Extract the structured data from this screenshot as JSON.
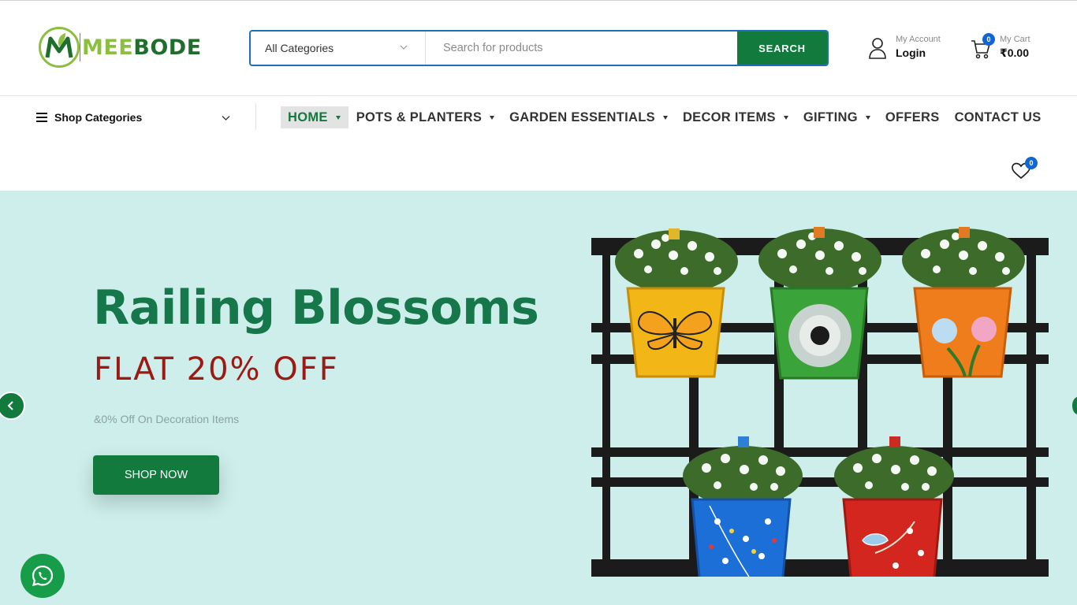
{
  "header": {
    "logo_text": "MEEBODE",
    "search": {
      "category_label": "All Categories",
      "placeholder": "Search for products",
      "button_label": "SEARCH"
    },
    "account": {
      "small_label": "My Account",
      "big_label": "Login"
    },
    "cart": {
      "small_label": "My Cart",
      "amount": "₹0.00",
      "count": "0"
    }
  },
  "nav": {
    "shop_categories_label": "Shop Categories",
    "items": [
      {
        "label": "HOME",
        "active": true,
        "dropdown": true
      },
      {
        "label": "POTS & PLANTERS",
        "dropdown": true
      },
      {
        "label": "GARDEN ESSENTIALS",
        "dropdown": true
      },
      {
        "label": "DECOR ITEMS",
        "dropdown": true
      },
      {
        "label": "GIFTING",
        "dropdown": true
      },
      {
        "label": "OFFERS",
        "dropdown": false
      },
      {
        "label": "CONTACT US",
        "dropdown": false
      }
    ],
    "wishlist_count": "0"
  },
  "hero": {
    "title": "Railing Blossoms",
    "subtitle": "FLAT 20% OFF",
    "note": "&0% Off On Decoration Items",
    "button_label": "SHOP NOW",
    "image_icon": "railing-planters-image"
  },
  "colors": {
    "brand_green": "#137a3e",
    "logo_light_green": "#8cbf3f",
    "search_border": "#1f6fb8",
    "hero_bg": "#cdeeea",
    "sale_red": "#9b1b14",
    "badge_blue": "#1266d4"
  }
}
